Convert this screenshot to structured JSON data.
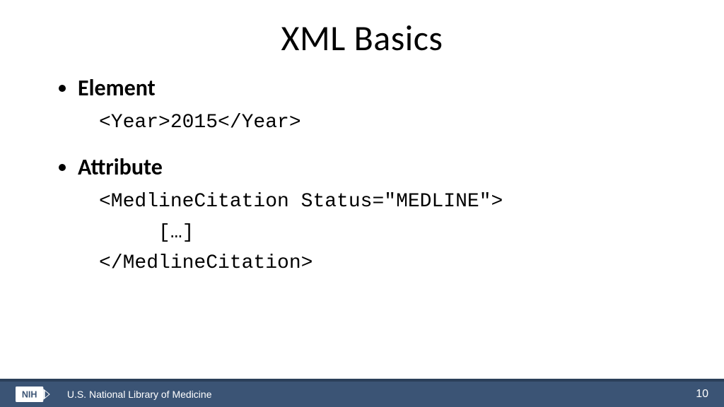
{
  "slide": {
    "title": "XML Basics",
    "bullets": [
      {
        "label": "Element",
        "code": "<Year>2015</Year>"
      },
      {
        "label": "Attribute",
        "code": "<MedlineCitation Status=\"MEDLINE\">\n     […]\n</MedlineCitation>"
      }
    ],
    "footer": {
      "org": "U.S. National Library of Medicine",
      "logo_text": "NIH",
      "page_number": "10"
    }
  }
}
